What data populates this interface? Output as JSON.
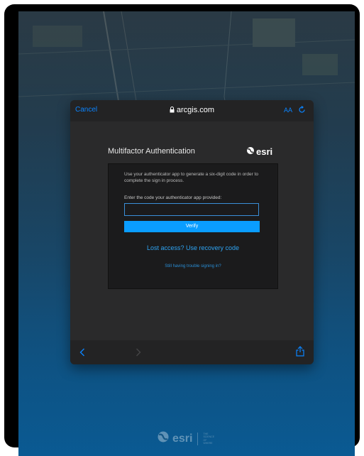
{
  "browser": {
    "cancel_label": "Cancel",
    "url": "arcgis.com",
    "text_size_label": "AA"
  },
  "page": {
    "title": "Multifactor Authentication",
    "logo_text": "esri",
    "instructions": "Use your authenticator app to generate a six-digit code in order to complete the sign in process.",
    "code_label": "Enter the code your authenticator app provided:",
    "code_value": "",
    "verify_label": "Verify",
    "recovery_link": "Lost access? Use recovery code",
    "trouble_link": "Still having trouble signing in?"
  },
  "footer": {
    "logo_text": "esri",
    "tagline": [
      "THE",
      "SCIENCE",
      "OF",
      "WHERE"
    ]
  },
  "colors": {
    "accent": "#0a84ff",
    "verify_button": "#0a9dff",
    "link": "#2ea3f2",
    "card_bg": "#1b1b1c",
    "popup_bg": "#2a2a2b"
  },
  "icons": [
    "lock-icon",
    "reload-icon",
    "esri-globe-icon",
    "back-icon",
    "forward-icon",
    "share-icon"
  ]
}
